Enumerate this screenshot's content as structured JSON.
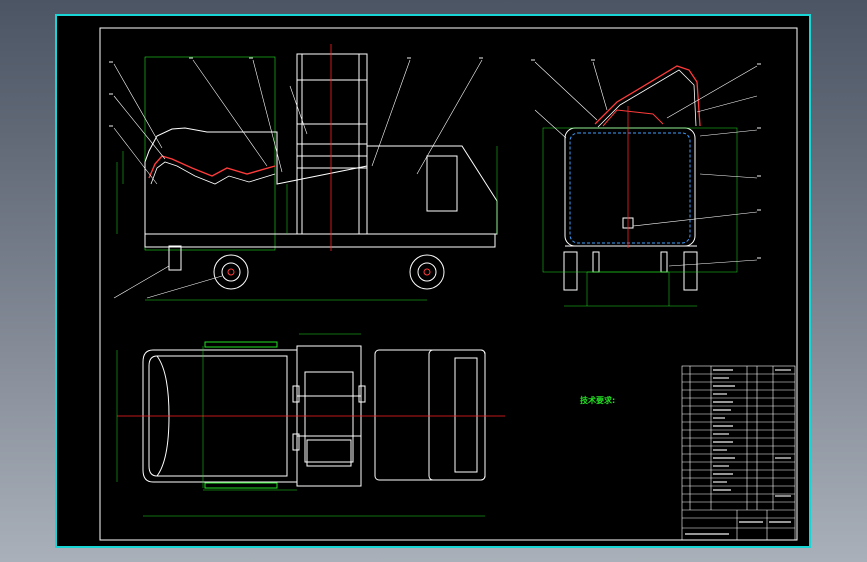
{
  "drawing": {
    "tech_requirements": {
      "title": "技术要求:",
      "lines": []
    }
  },
  "colors": {
    "frame": "#18d6d6",
    "lines": "#ffffff",
    "centerline": "#ff2020",
    "dimension": "#22e022",
    "hatch": "#3fa0ff",
    "background": "#000000"
  }
}
